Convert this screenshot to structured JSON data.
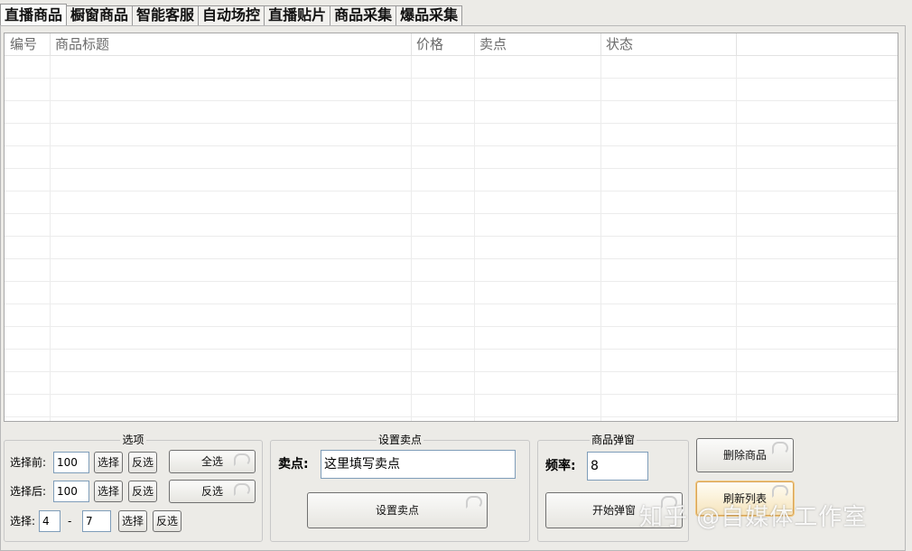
{
  "tabs": [
    "直播商品",
    "橱窗商品",
    "智能客服",
    "自动场控",
    "直播贴片",
    "商品采集",
    "爆品采集"
  ],
  "table": {
    "columns": [
      "编号",
      "商品标题",
      "价格",
      "卖点",
      "状态"
    ]
  },
  "options_group": {
    "title": "选项",
    "before_label": "选择前:",
    "before_value": "100",
    "after_label": "选择后:",
    "after_value": "100",
    "range_label": "选择:",
    "range_from": "4",
    "range_dash": "-",
    "range_to": "7",
    "select_label": "选择",
    "invert_label": "反选",
    "select_all_label": "全选",
    "invert_all_label": "反选"
  },
  "selling_point_group": {
    "title": "设置卖点",
    "field_label": "卖点:",
    "field_value": "这里填写卖点",
    "button_label": "设置卖点"
  },
  "popup_group": {
    "title": "商品弹窗",
    "freq_label": "频率:",
    "freq_value": "8",
    "start_label": "开始弹窗"
  },
  "actions": {
    "delete_label": "删除商品",
    "refresh_label": "刷新列表"
  },
  "watermark": "知乎 @自媒体工作室"
}
